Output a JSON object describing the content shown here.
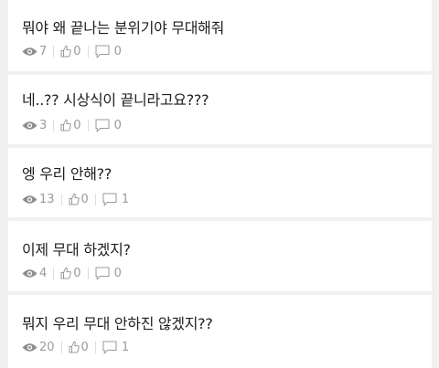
{
  "posts": [
    {
      "title": "뭐야 왜 끝나는 분위기야 무대해줘",
      "views": "7",
      "likes": "0",
      "comments": "0"
    },
    {
      "title": "네..?? 시상식이 끝니라고요???",
      "views": "3",
      "likes": "0",
      "comments": "0"
    },
    {
      "title": "엥 우리 안해??",
      "views": "13",
      "likes": "0",
      "comments": "1"
    },
    {
      "title": "이제 무대 하겠지?",
      "views": "4",
      "likes": "0",
      "comments": "0"
    },
    {
      "title": "뭐지 우리 무대 안하진 않겠지??",
      "views": "20",
      "likes": "0",
      "comments": "1"
    }
  ]
}
